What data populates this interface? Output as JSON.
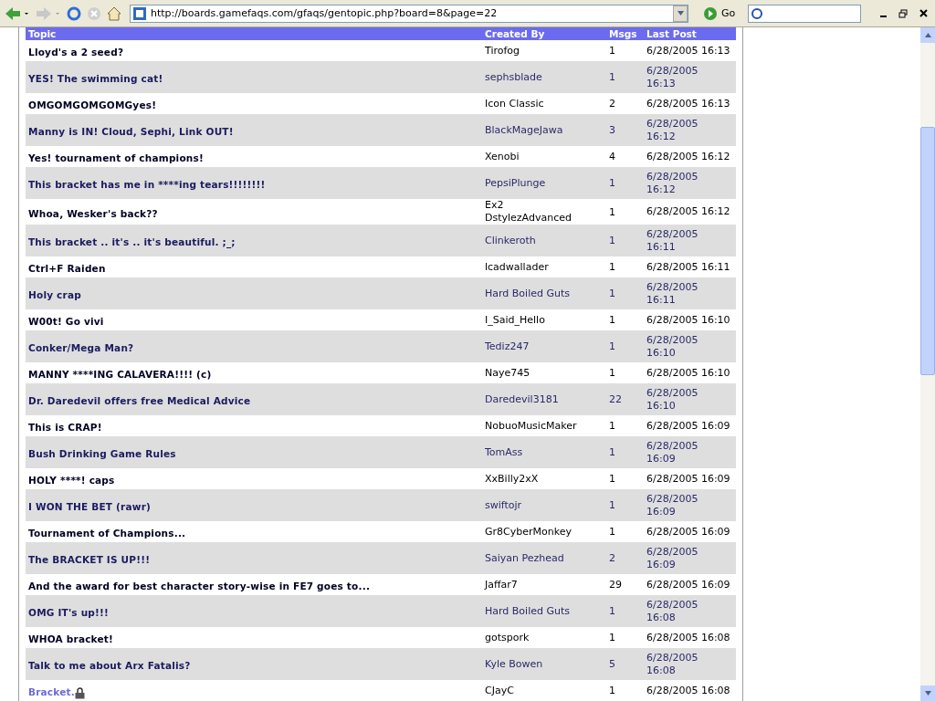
{
  "toolbar": {
    "address": "http://boards.gamefaqs.com/gfaqs/gentopic.php?board=8&page=22",
    "go": "Go"
  },
  "table": {
    "columns": [
      "Topic",
      "Created By",
      "Msgs",
      "Last Post"
    ],
    "rows": [
      {
        "topic": "Lloyd's a 2 seed?",
        "created_by": "Tirofog",
        "msgs": "1",
        "last_post": "6/28/2005 16:13",
        "locked": false
      },
      {
        "topic": "YES! The swimming cat!",
        "created_by": "sephsblade",
        "msgs": "1",
        "last_post": "6/28/2005 16:13",
        "locked": false
      },
      {
        "topic": "OMGOMGOMGOMGyes!",
        "created_by": "Icon Classic",
        "msgs": "2",
        "last_post": "6/28/2005 16:13",
        "locked": false
      },
      {
        "topic": "Manny is IN! Cloud, Sephi, Link OUT!",
        "created_by": "BlackMageJawa",
        "msgs": "3",
        "last_post": "6/28/2005 16:12",
        "locked": false
      },
      {
        "topic": "Yes! tournament of champions!",
        "created_by": "Xenobi",
        "msgs": "4",
        "last_post": "6/28/2005 16:12",
        "locked": false
      },
      {
        "topic": "This bracket has me in ****ing tears!!!!!!!!",
        "created_by": "PepsiPlunge",
        "msgs": "1",
        "last_post": "6/28/2005 16:12",
        "locked": false
      },
      {
        "topic": "Whoa, Wesker's back??",
        "created_by": "Ex2 DstylezAdvanced",
        "msgs": "1",
        "last_post": "6/28/2005 16:12",
        "locked": false
      },
      {
        "topic": "This bracket .. it's .. it's beautiful. ;_;",
        "created_by": "Clinkeroth",
        "msgs": "1",
        "last_post": "6/28/2005 16:11",
        "locked": false
      },
      {
        "topic": "Ctrl+F Raiden",
        "created_by": "lcadwallader",
        "msgs": "1",
        "last_post": "6/28/2005 16:11",
        "locked": false
      },
      {
        "topic": "Holy crap",
        "created_by": "Hard Boiled Guts",
        "msgs": "1",
        "last_post": "6/28/2005 16:11",
        "locked": false
      },
      {
        "topic": "W00t! Go vivi",
        "created_by": "I_Said_Hello",
        "msgs": "1",
        "last_post": "6/28/2005 16:10",
        "locked": false
      },
      {
        "topic": "Conker/Mega Man?",
        "created_by": "Tediz247",
        "msgs": "1",
        "last_post": "6/28/2005 16:10",
        "locked": false
      },
      {
        "topic": "MANNY ****ING CALAVERA!!!! (c)",
        "created_by": "Naye745",
        "msgs": "1",
        "last_post": "6/28/2005 16:10",
        "locked": false
      },
      {
        "topic": "Dr. Daredevil offers free Medical Advice",
        "created_by": "Daredevil3181",
        "msgs": "22",
        "last_post": "6/28/2005 16:10",
        "locked": false
      },
      {
        "topic": "This is CRAP!",
        "created_by": "NobuoMusicMaker",
        "msgs": "1",
        "last_post": "6/28/2005 16:09",
        "locked": false
      },
      {
        "topic": "Bush Drinking Game Rules",
        "created_by": "TomAss",
        "msgs": "1",
        "last_post": "6/28/2005 16:09",
        "locked": false
      },
      {
        "topic": "HOLY ****! caps",
        "created_by": "XxBilly2xX",
        "msgs": "1",
        "last_post": "6/28/2005 16:09",
        "locked": false
      },
      {
        "topic": "I WON THE BET (rawr)",
        "created_by": "swiftojr",
        "msgs": "1",
        "last_post": "6/28/2005 16:09",
        "locked": false
      },
      {
        "topic": "Tournament of Champions...",
        "created_by": "Gr8CyberMonkey",
        "msgs": "1",
        "last_post": "6/28/2005 16:09",
        "locked": false
      },
      {
        "topic": "The BRACKET IS UP!!!",
        "created_by": "Saiyan Pezhead",
        "msgs": "2",
        "last_post": "6/28/2005 16:09",
        "locked": false
      },
      {
        "topic": "And the award for best character story-wise in FE7 goes to...",
        "created_by": "Jaffar7",
        "msgs": "29",
        "last_post": "6/28/2005 16:09",
        "locked": false
      },
      {
        "topic": "OMG IT's up!!!",
        "created_by": "Hard Boiled Guts",
        "msgs": "1",
        "last_post": "6/28/2005 16:08",
        "locked": false
      },
      {
        "topic": "WHOA bracket!",
        "created_by": "gotspork",
        "msgs": "1",
        "last_post": "6/28/2005 16:08",
        "locked": false
      },
      {
        "topic": "Talk to me about Arx Fatalis?",
        "created_by": "Kyle Bowen",
        "msgs": "5",
        "last_post": "6/28/2005 16:08",
        "locked": false
      },
      {
        "topic": "Bracket.",
        "created_by": "CJayC",
        "msgs": "1",
        "last_post": "6/28/2005 16:08",
        "locked": true
      }
    ]
  }
}
